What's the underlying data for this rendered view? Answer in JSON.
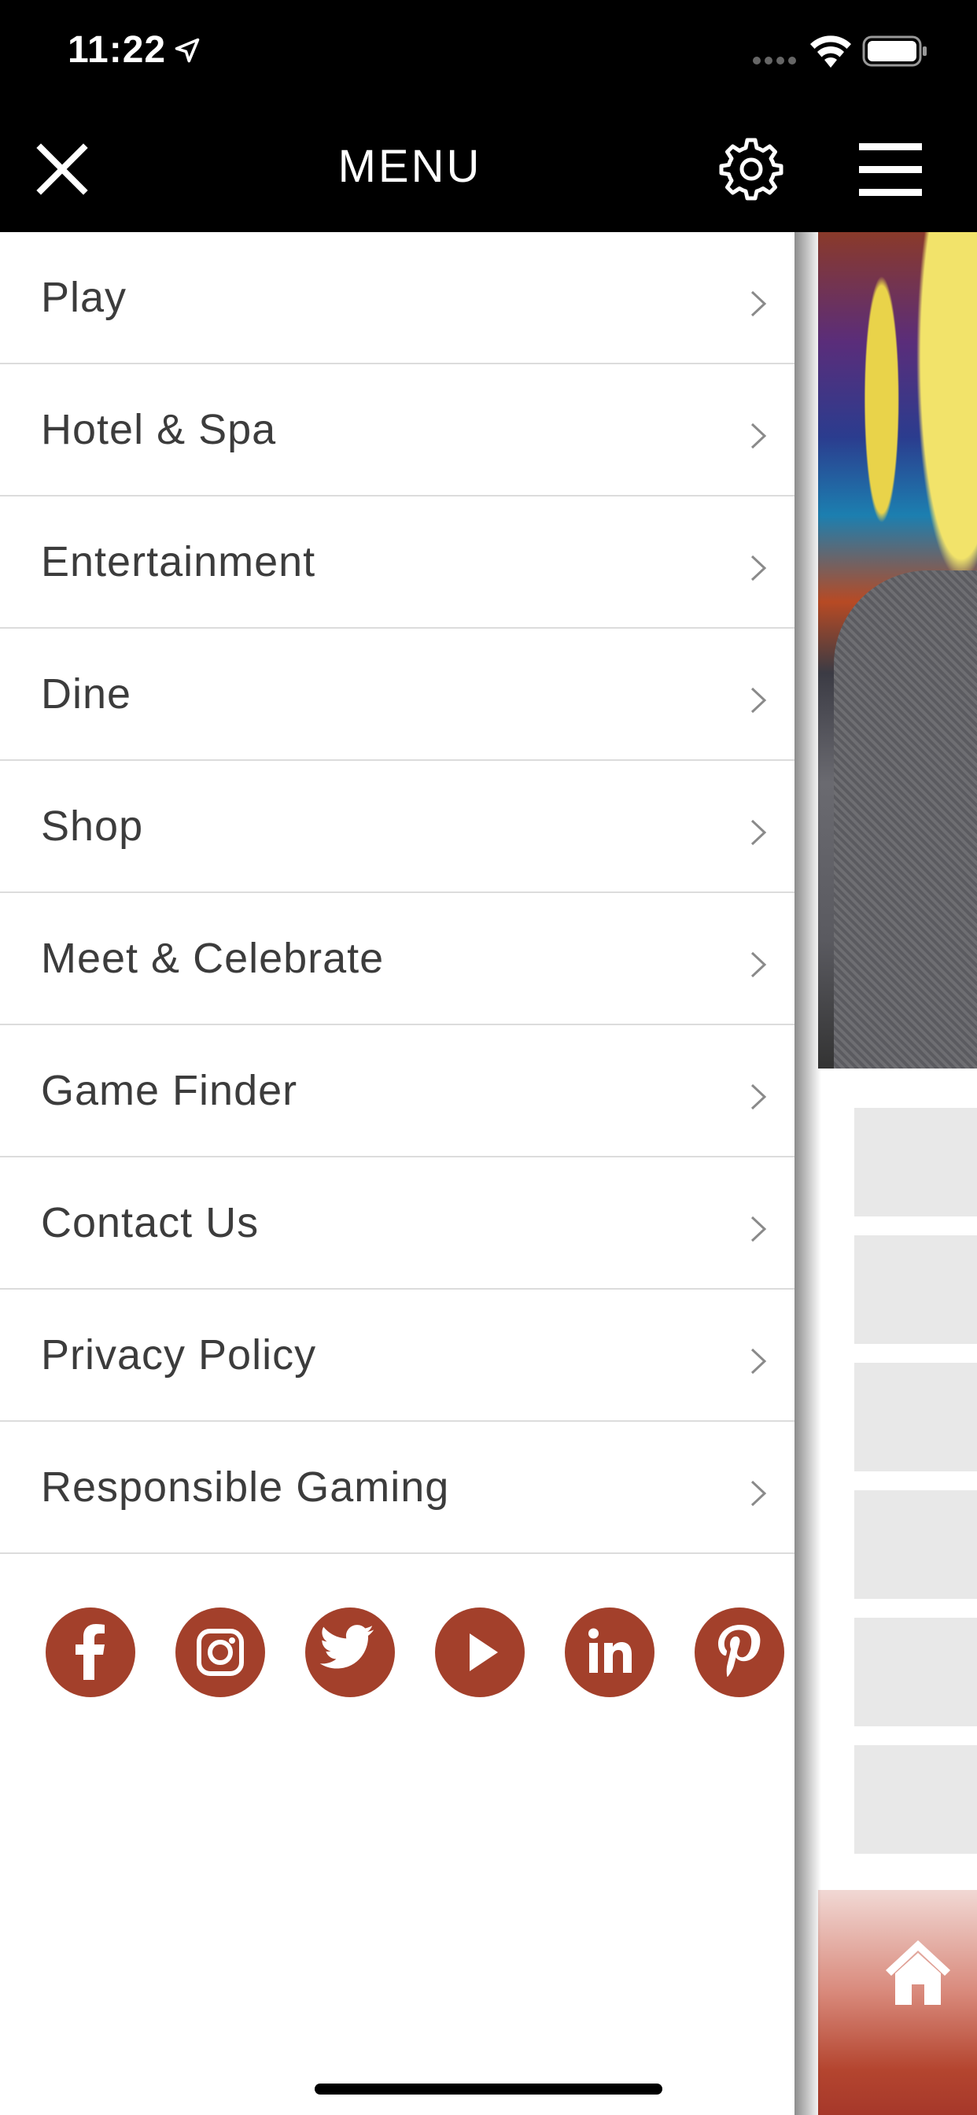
{
  "status_bar": {
    "time": "11:22"
  },
  "header": {
    "title": "MENU"
  },
  "menu": {
    "items": [
      {
        "label": "Play"
      },
      {
        "label": "Hotel & Spa"
      },
      {
        "label": "Entertainment"
      },
      {
        "label": "Dine"
      },
      {
        "label": "Shop"
      },
      {
        "label": "Meet & Celebrate"
      },
      {
        "label": "Game Finder"
      },
      {
        "label": "Contact Us"
      },
      {
        "label": "Privacy Policy"
      },
      {
        "label": "Responsible Gaming"
      }
    ]
  },
  "social": {
    "icons": [
      "facebook-icon",
      "instagram-icon",
      "twitter-icon",
      "youtube-icon",
      "linkedin-icon",
      "pinterest-icon"
    ]
  },
  "colors": {
    "header_bg": "#000000",
    "accent": "#a3402b",
    "menu_text": "#3c3c3c",
    "divider": "#dcdcdc"
  }
}
